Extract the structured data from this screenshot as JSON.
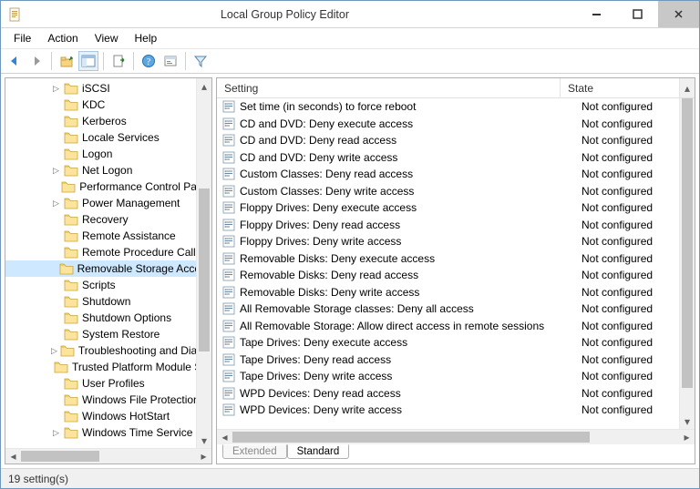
{
  "window": {
    "title": "Local Group Policy Editor"
  },
  "menu": {
    "file": "File",
    "action": "Action",
    "view": "View",
    "help": "Help"
  },
  "tree": {
    "items": [
      {
        "label": "iSCSI",
        "expander": "▷"
      },
      {
        "label": "KDC",
        "expander": ""
      },
      {
        "label": "Kerberos",
        "expander": ""
      },
      {
        "label": "Locale Services",
        "expander": ""
      },
      {
        "label": "Logon",
        "expander": ""
      },
      {
        "label": "Net Logon",
        "expander": "▷"
      },
      {
        "label": "Performance Control Panel",
        "expander": ""
      },
      {
        "label": "Power Management",
        "expander": "▷"
      },
      {
        "label": "Recovery",
        "expander": ""
      },
      {
        "label": "Remote Assistance",
        "expander": ""
      },
      {
        "label": "Remote Procedure Call",
        "expander": ""
      },
      {
        "label": "Removable Storage Access",
        "expander": "",
        "selected": true
      },
      {
        "label": "Scripts",
        "expander": ""
      },
      {
        "label": "Shutdown",
        "expander": ""
      },
      {
        "label": "Shutdown Options",
        "expander": ""
      },
      {
        "label": "System Restore",
        "expander": ""
      },
      {
        "label": "Troubleshooting and Diagnostics",
        "expander": "▷"
      },
      {
        "label": "Trusted Platform Module Services",
        "expander": ""
      },
      {
        "label": "User Profiles",
        "expander": ""
      },
      {
        "label": "Windows File Protection",
        "expander": ""
      },
      {
        "label": "Windows HotStart",
        "expander": ""
      },
      {
        "label": "Windows Time Service",
        "expander": "▷"
      }
    ]
  },
  "list": {
    "header": {
      "setting": "Setting",
      "state": "State"
    },
    "rows": [
      {
        "setting": "Set time (in seconds) to force reboot",
        "state": "Not configured"
      },
      {
        "setting": "CD and DVD: Deny execute access",
        "state": "Not configured"
      },
      {
        "setting": "CD and DVD: Deny read access",
        "state": "Not configured"
      },
      {
        "setting": "CD and DVD: Deny write access",
        "state": "Not configured"
      },
      {
        "setting": "Custom Classes: Deny read access",
        "state": "Not configured"
      },
      {
        "setting": "Custom Classes: Deny write access",
        "state": "Not configured"
      },
      {
        "setting": "Floppy Drives: Deny execute access",
        "state": "Not configured"
      },
      {
        "setting": "Floppy Drives: Deny read access",
        "state": "Not configured"
      },
      {
        "setting": "Floppy Drives: Deny write access",
        "state": "Not configured"
      },
      {
        "setting": "Removable Disks: Deny execute access",
        "state": "Not configured"
      },
      {
        "setting": "Removable Disks: Deny read access",
        "state": "Not configured"
      },
      {
        "setting": "Removable Disks: Deny write access",
        "state": "Not configured"
      },
      {
        "setting": "All Removable Storage classes: Deny all access",
        "state": "Not configured"
      },
      {
        "setting": "All Removable Storage: Allow direct access in remote sessions",
        "state": "Not configured"
      },
      {
        "setting": "Tape Drives: Deny execute access",
        "state": "Not configured"
      },
      {
        "setting": "Tape Drives: Deny read access",
        "state": "Not configured"
      },
      {
        "setting": "Tape Drives: Deny write access",
        "state": "Not configured"
      },
      {
        "setting": "WPD Devices: Deny read access",
        "state": "Not configured"
      },
      {
        "setting": "WPD Devices: Deny write access",
        "state": "Not configured"
      }
    ]
  },
  "tabs": {
    "extended": "Extended",
    "standard": "Standard"
  },
  "status": {
    "text": "19 setting(s)"
  }
}
